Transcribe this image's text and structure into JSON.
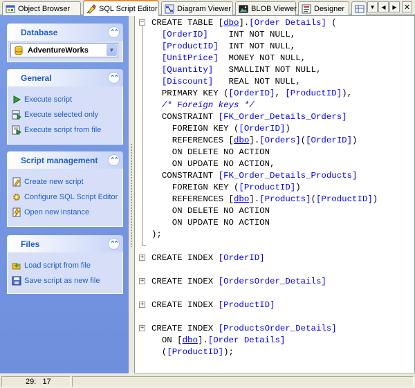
{
  "tabs": [
    {
      "label": "Object Browser",
      "icon": "object-browser-icon",
      "active": false
    },
    {
      "label": "SQL Script Editor",
      "icon": "sql-script-icon",
      "active": true
    },
    {
      "label": "Diagram Viewer",
      "icon": "diagram-icon",
      "active": false
    },
    {
      "label": "BLOB Viewer",
      "icon": "blob-icon",
      "active": false
    },
    {
      "label": "Designer",
      "icon": "designer-icon",
      "active": false
    }
  ],
  "sidebar": {
    "database": {
      "title": "Database",
      "selected": "AdventureWorks"
    },
    "general": {
      "title": "General",
      "items": [
        {
          "label": "Execute script",
          "icon": "play-icon"
        },
        {
          "label": "Execute selected only",
          "icon": "execute-selected-icon"
        },
        {
          "label": "Execute script from file",
          "icon": "execute-file-icon"
        }
      ]
    },
    "script_management": {
      "title": "Script management",
      "items": [
        {
          "label": "Create new script",
          "icon": "new-script-icon"
        },
        {
          "label": "Configure SQL Script Editor",
          "icon": "configure-icon"
        },
        {
          "label": "Open new instance",
          "icon": "new-instance-icon"
        }
      ]
    },
    "files": {
      "title": "Files",
      "items": [
        {
          "label": "Load script from file",
          "icon": "load-file-icon"
        },
        {
          "label": "Save script as new file",
          "icon": "save-file-icon"
        }
      ]
    }
  },
  "editor": {
    "lines": [
      "CREATE TABLE [dbo].[Order Details] (",
      "  [OrderID]    INT NOT NULL,",
      "  [ProductID]  INT NOT NULL,",
      "  [UnitPrice]  MONEY NOT NULL,",
      "  [Quantity]   SMALLINT NOT NULL,",
      "  [Discount]   REAL NOT NULL,",
      "  PRIMARY KEY ([OrderID], [ProductID]),",
      "  /* Foreign keys */",
      "  CONSTRAINT [FK_Order_Details_Orders]",
      "    FOREIGN KEY ([OrderID])",
      "    REFERENCES [dbo].[Orders]([OrderID])",
      "    ON DELETE NO ACTION",
      "    ON UPDATE NO ACTION,",
      "  CONSTRAINT [FK_Order_Details_Products]",
      "    FOREIGN KEY ([ProductID])",
      "    REFERENCES [dbo].[Products]([ProductID])",
      "    ON DELETE NO ACTION",
      "    ON UPDATE NO ACTION",
      ");",
      "CREATE INDEX [OrderID]",
      "CREATE INDEX [OrdersOrder_Details]",
      "CREATE INDEX [ProductID]",
      "CREATE INDEX [ProductsOrder_Details]",
      "  ON [dbo].[Order Details]",
      "  ([ProductID]);"
    ]
  },
  "status": {
    "line": "29",
    "column": "17"
  }
}
